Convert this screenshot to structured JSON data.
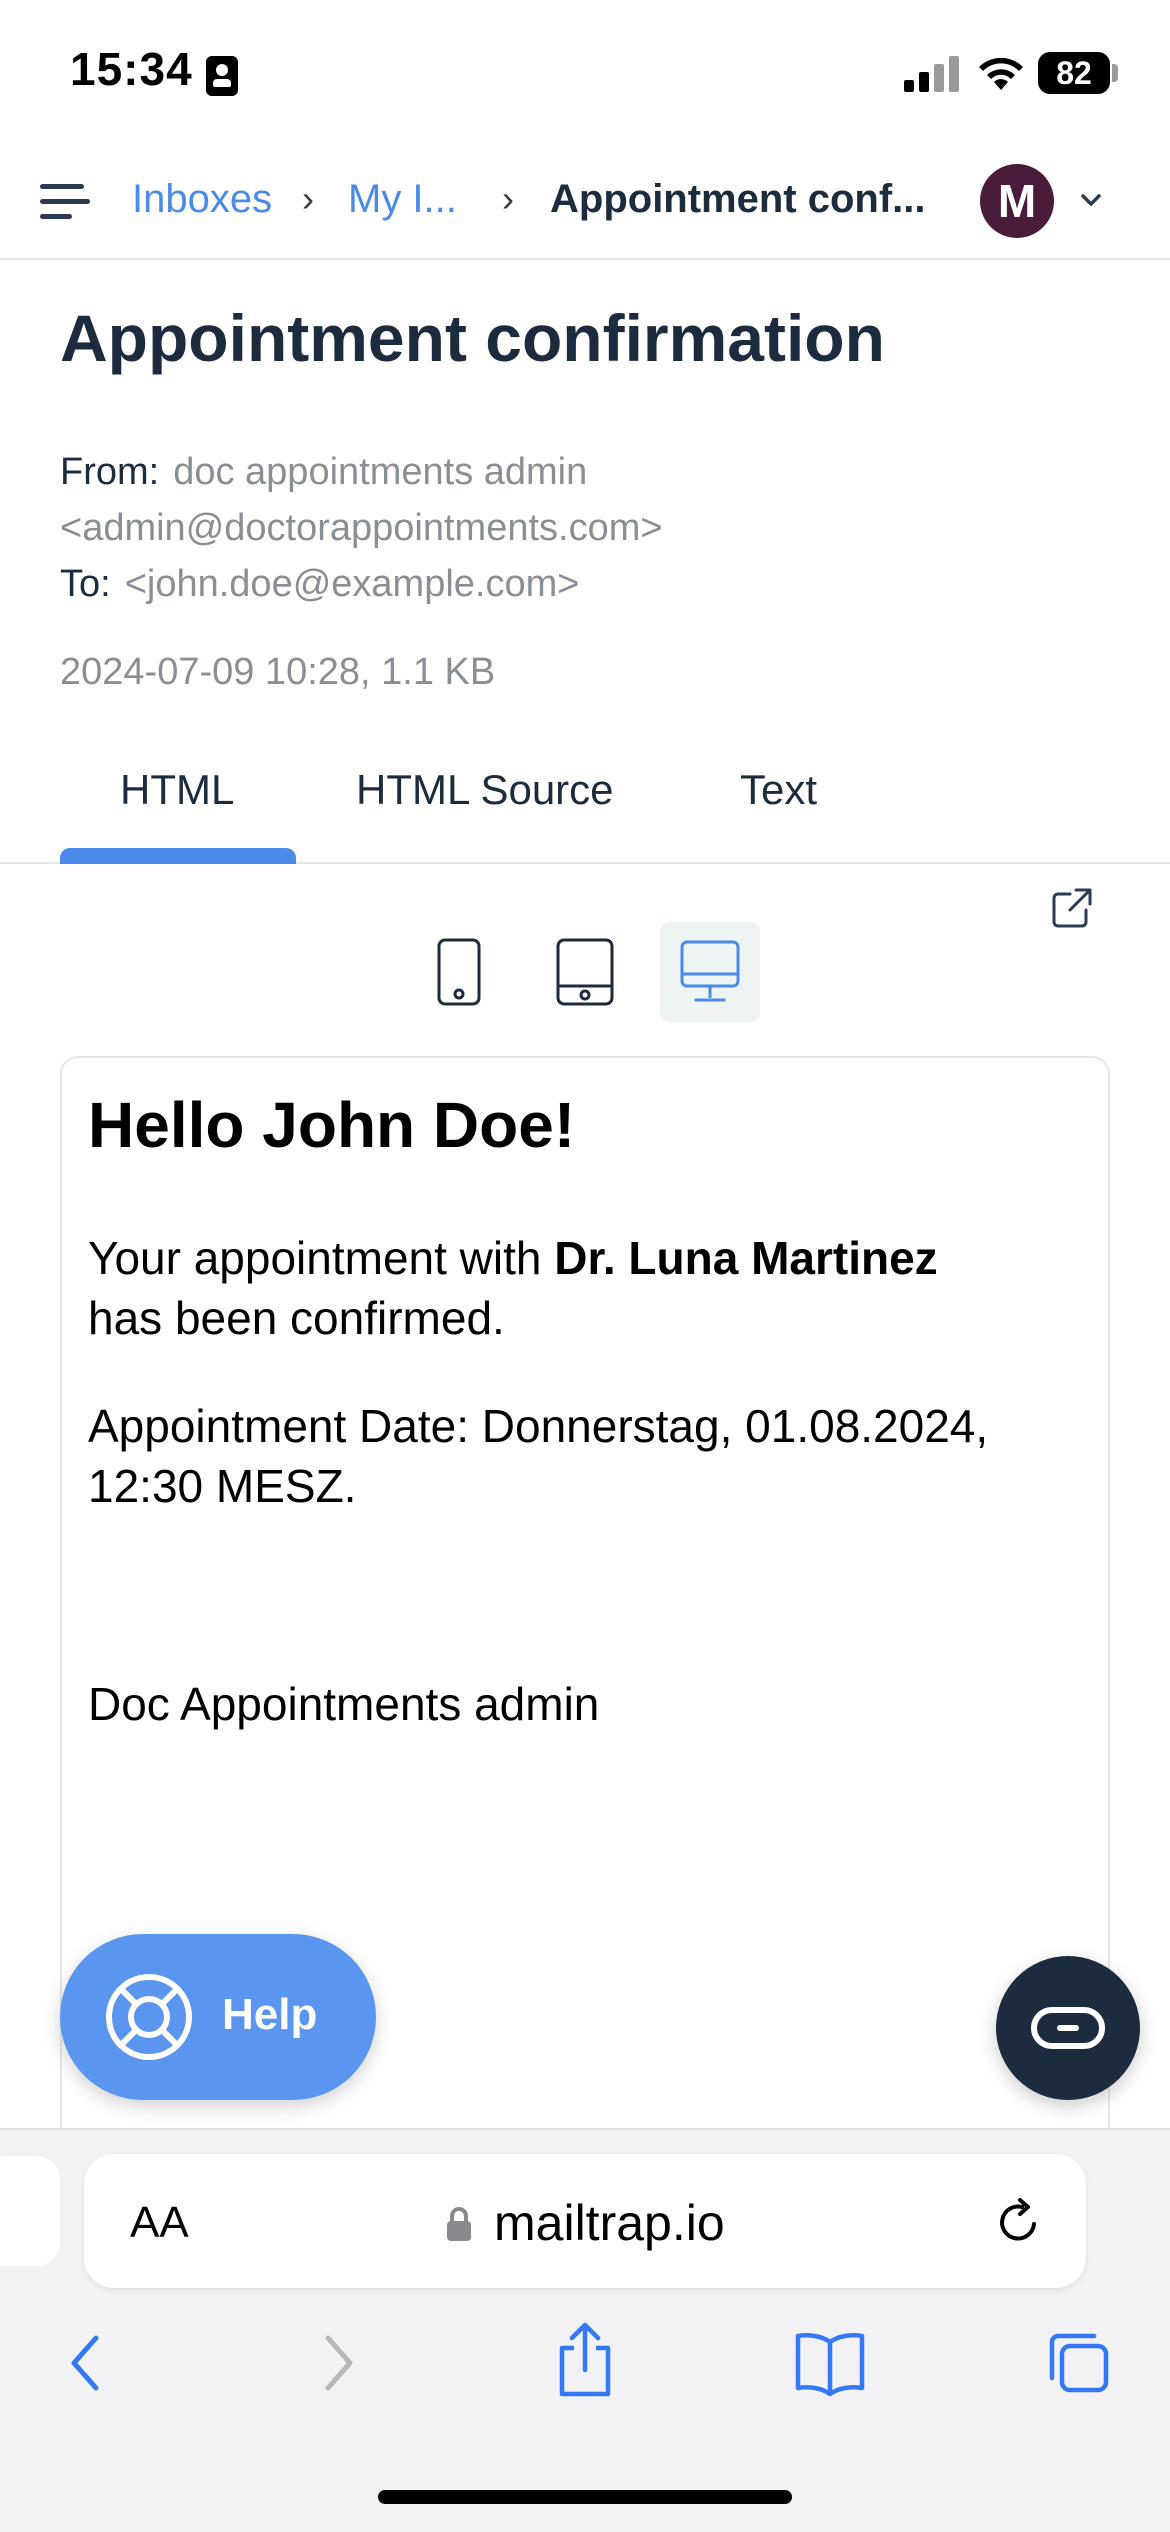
{
  "status_bar": {
    "time": "15:34",
    "battery": "82"
  },
  "breadcrumb": {
    "items": [
      "Inboxes",
      "My I...",
      "Appointment conf..."
    ],
    "separator": "›"
  },
  "user": {
    "avatar_initial": "M",
    "avatar_color": "#4a1c3a"
  },
  "message": {
    "title": "Appointment confirmation",
    "from_label": "From:",
    "from_name": "doc appointments admin",
    "from_email": "<admin@doctorappointments.com>",
    "to_label": "To:",
    "to_email": "<john.doe@example.com>",
    "date_size": "2024-07-09 10:28, 1.1 KB"
  },
  "tabs": [
    "HTML",
    "HTML Source",
    "Text"
  ],
  "active_tab": "HTML",
  "device_views": [
    "mobile",
    "tablet",
    "desktop"
  ],
  "active_device_view": "desktop",
  "email_body": {
    "greeting": "Hello John Doe!",
    "line1_prefix": "Your appointment with ",
    "doctor": "Dr. Luna Martinez",
    "line1_suffix": "has been confirmed.",
    "line2": "Appointment Date: Donnerstag, 01.08.2024, 12:30 MESZ.",
    "signature": "Doc Appointments admin"
  },
  "help_button": {
    "label": "Help"
  },
  "browser": {
    "aa_label": "AA",
    "url": "mailtrap.io"
  },
  "colors": {
    "accent": "#4a8bea",
    "text": "#1c2b3d",
    "muted": "#8a8f96",
    "help": "#5a95ef",
    "chat": "#1c2b3d"
  },
  "icons": [
    "menu-icon",
    "chevron-down-icon",
    "external-link-icon",
    "mobile-icon",
    "tablet-icon",
    "desktop-icon",
    "lifebuoy-icon",
    "chat-icon",
    "lock-icon",
    "reload-icon",
    "back-icon",
    "forward-icon",
    "share-icon",
    "bookmarks-icon",
    "tabs-icon"
  ]
}
